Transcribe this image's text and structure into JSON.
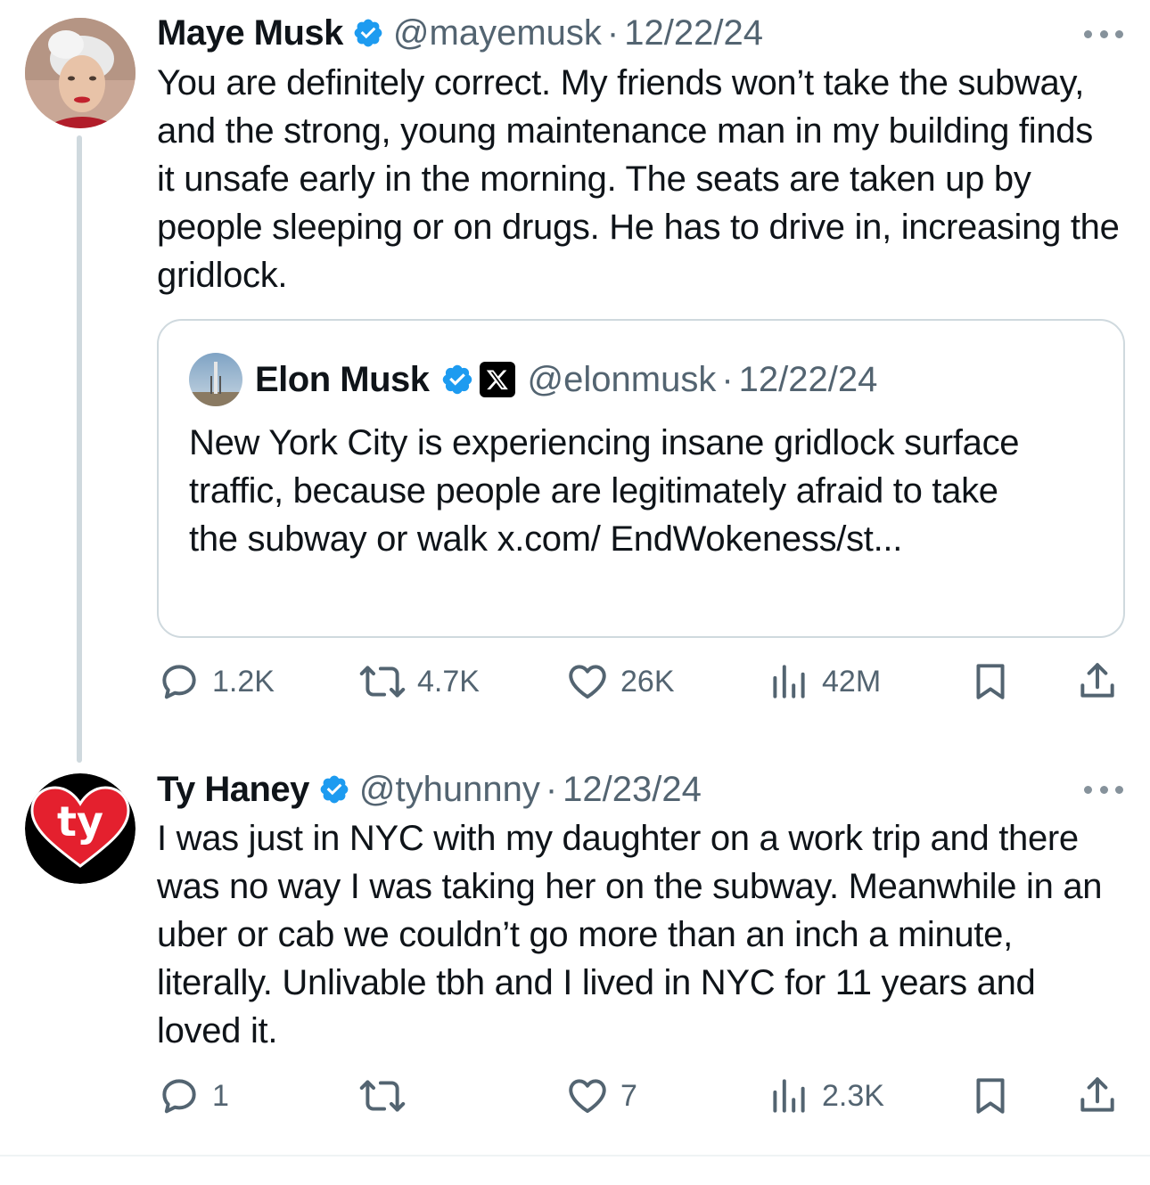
{
  "tweets": [
    {
      "name": "Maye Musk",
      "handle": "@mayemusk",
      "separator": "·",
      "date": "12/22/24",
      "text": "You are definitely correct. My friends won’t take the subway, and the strong, young maintenance man in my building finds it unsafe early in the morning. The seats are taken up by people sleeping or on drugs. He has to drive in, increasing the gridlock.",
      "quote": {
        "name": "Elon Musk",
        "handle": "@elonmusk",
        "separator": "·",
        "date": "12/22/24",
        "text": "New York City is experiencing insane gridlock surface traffic, because people are legitimately afraid to take the subway or walk x.com/ EndWokeness/st..."
      },
      "stats": {
        "replies": "1.2K",
        "reposts": "4.7K",
        "likes": "26K",
        "views": "42M"
      }
    },
    {
      "name": "Ty Haney",
      "handle": "@tyhunnny",
      "separator": "·",
      "date": "12/23/24",
      "text": "I was just in NYC with my daughter on a work trip and there was no way I was taking her on the subway. Meanwhile in an uber or cab we couldn’t go more than an inch a minute, literally. Unlivable tbh and I lived in NYC for 11 years and loved it.",
      "stats": {
        "replies": "1",
        "reposts": "",
        "likes": "7",
        "views": "2.3K"
      }
    }
  ],
  "ty_logo_text": "ty",
  "colors": {
    "verified": "#1d9bf0",
    "secondary_text": "#536471",
    "border": "#cfd9de",
    "ty_red": "#e4202e"
  },
  "icons": [
    "reply-icon",
    "repost-icon",
    "like-icon",
    "views-icon",
    "bookmark-icon",
    "share-icon",
    "more-icon",
    "verified-badge-icon",
    "x-affiliate-icon"
  ]
}
